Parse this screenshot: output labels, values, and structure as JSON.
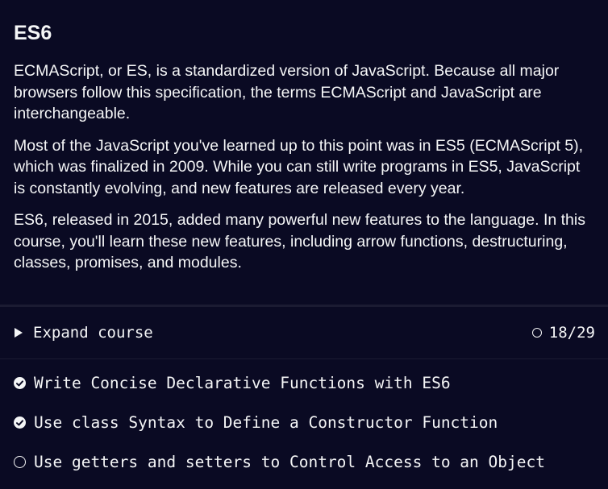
{
  "intro": {
    "title": "ES6",
    "paragraphs": [
      "ECMAScript, or ES, is a standardized version of JavaScript. Because all major browsers follow this specification, the terms ECMAScript and JavaScript are interchangeable.",
      "Most of the JavaScript you've learned up to this point was in ES5 (ECMAScript 5), which was finalized in 2009. While you can still write programs in ES5, JavaScript is constantly evolving, and new features are released every year.",
      "ES6, released in 2015, added many powerful new features to the language. In this course, you'll learn these new features, including arrow functions, destructuring, classes, promises, and modules."
    ]
  },
  "expand": {
    "label": "Expand course",
    "icon": "triangle-right-icon",
    "progress": "18/29",
    "progress_icon": "circle-outline-icon"
  },
  "lessons": [
    {
      "label": "Write Concise Declarative Functions with ES6",
      "completed": true,
      "icon": "check-circle-icon"
    },
    {
      "label": "Use class Syntax to Define a Constructor Function",
      "completed": true,
      "icon": "check-circle-icon"
    },
    {
      "label": "Use getters and setters to Control Access to an Object",
      "completed": false,
      "icon": "circle-outline-icon"
    }
  ],
  "colors": {
    "background": "#0a0a23",
    "text": "#f5f6f7",
    "divider": "#1b1b32"
  }
}
